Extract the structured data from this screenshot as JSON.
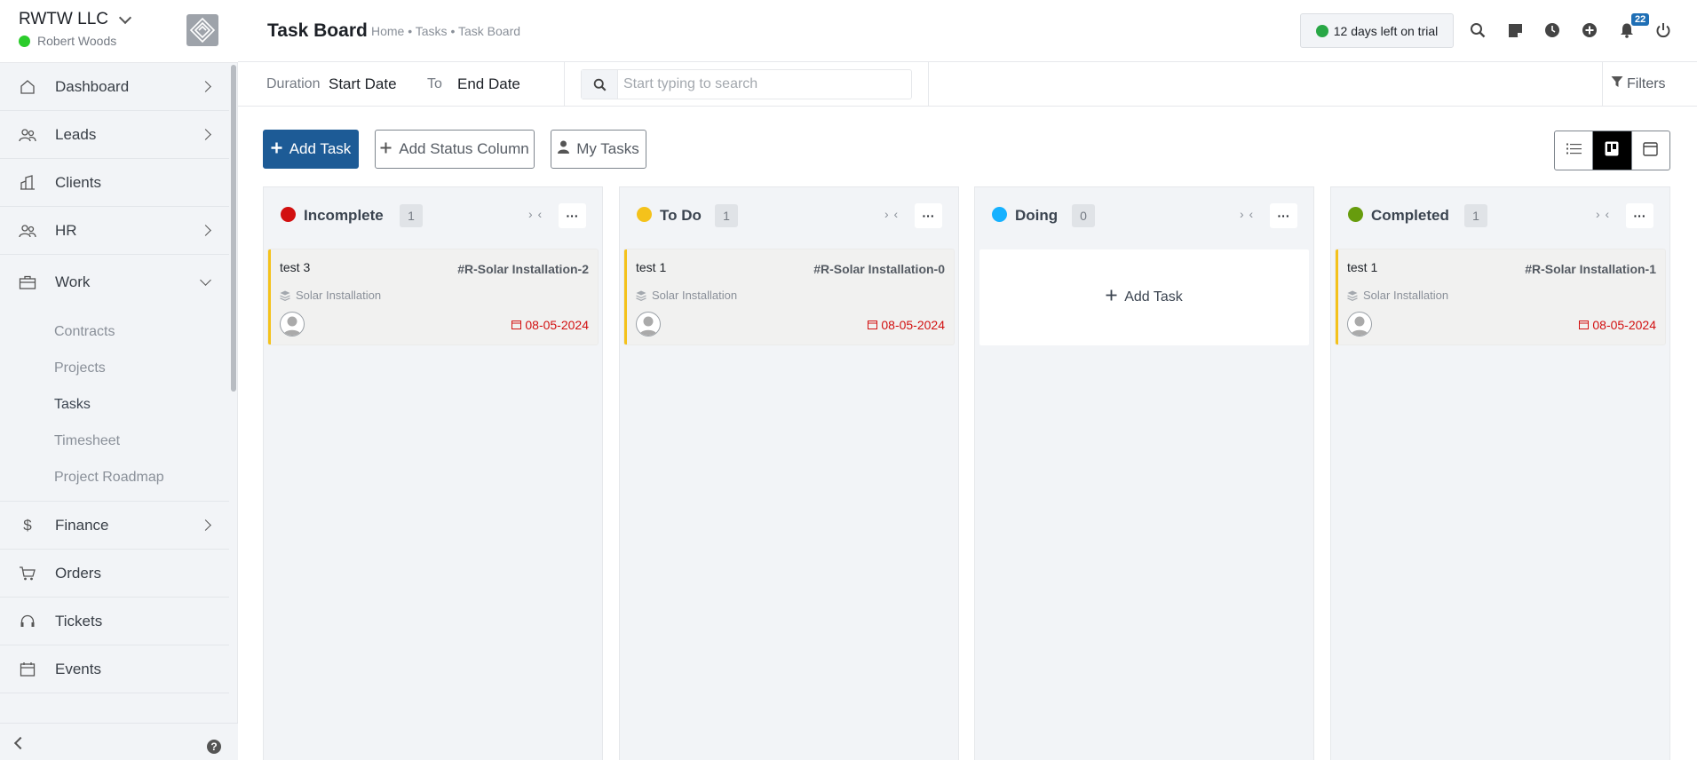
{
  "sidebar": {
    "company": "RWTW LLC",
    "user": "Robert Woods",
    "items": [
      {
        "label": "Dashboard"
      },
      {
        "label": "Leads"
      },
      {
        "label": "Clients"
      },
      {
        "label": "HR"
      },
      {
        "label": "Work"
      },
      {
        "label": "Finance"
      },
      {
        "label": "Orders"
      },
      {
        "label": "Tickets"
      },
      {
        "label": "Events"
      }
    ],
    "work_sub": [
      "Contracts",
      "Projects",
      "Tasks",
      "Timesheet",
      "Project Roadmap"
    ],
    "help_glyph": "?"
  },
  "header": {
    "title": "Task Board",
    "breadcrumb": "Home • Tasks • Task Board",
    "trial": "12 days left on trial",
    "notification_count": "22"
  },
  "filterbar": {
    "duration_label": "Duration",
    "start_date": "Start Date",
    "to_label": "To",
    "end_date": "End Date",
    "search_placeholder": "Start typing to search",
    "filters_label": "Filters"
  },
  "toolbar": {
    "add_task": "Add Task",
    "add_status_column": "Add Status Column",
    "my_tasks": "My Tasks"
  },
  "board": {
    "columns": [
      {
        "title": "Incomplete",
        "count": "1",
        "color": "#d21010",
        "card": {
          "name": "test 3",
          "code": "#R-Solar Installation-2",
          "project": "Solar Installation",
          "date": "08-05-2024"
        }
      },
      {
        "title": "To Do",
        "count": "1",
        "color": "#f4c21b",
        "card": {
          "name": "test 1",
          "code": "#R-Solar Installation-0",
          "project": "Solar Installation",
          "date": "08-05-2024"
        }
      },
      {
        "title": "Doing",
        "count": "0",
        "color": "#16b1ff",
        "add_task": "Add Task"
      },
      {
        "title": "Completed",
        "count": "1",
        "color": "#679c0d",
        "card": {
          "name": "test 1",
          "code": "#R-Solar Installation-1",
          "project": "Solar Installation",
          "date": "08-05-2024"
        }
      }
    ],
    "collapse_glyph": "› ‹",
    "more_glyph": "···"
  },
  "colors": {
    "primary": "#1d5b96",
    "overdue": "#d21010",
    "card_border": "#f4c21b"
  }
}
